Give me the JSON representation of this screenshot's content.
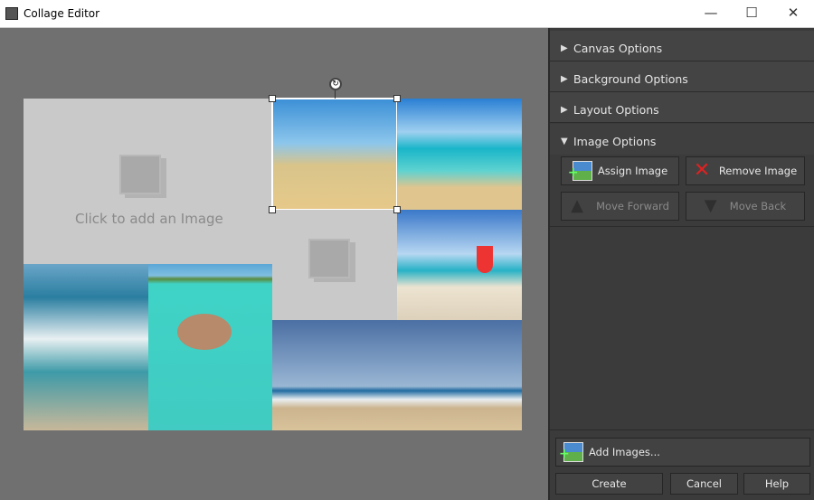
{
  "window": {
    "title": "Collage Editor",
    "minimize": "—",
    "maximize": "☐",
    "close": "✕"
  },
  "canvas": {
    "placeholder_text": "Click to add an Image",
    "rotate_icon": "↻"
  },
  "panel": {
    "sections": [
      {
        "label": "Canvas Options",
        "expanded": false
      },
      {
        "label": "Background Options",
        "expanded": false
      },
      {
        "label": "Layout Options",
        "expanded": false
      },
      {
        "label": "Image Options",
        "expanded": true
      }
    ],
    "arrow_collapsed": "▶",
    "arrow_expanded": "▼",
    "assign_image": "Assign Image",
    "remove_image": "Remove Image",
    "move_forward": "Move Forward",
    "move_back": "Move Back",
    "add_images": "Add Images...",
    "create": "Create",
    "cancel": "Cancel",
    "help": "Help"
  }
}
